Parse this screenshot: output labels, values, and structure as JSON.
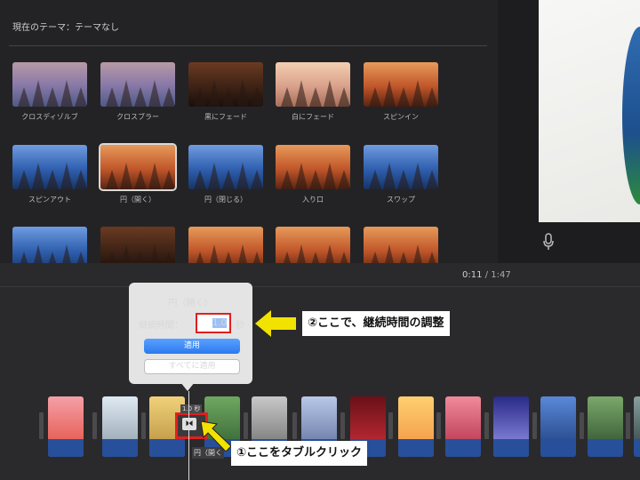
{
  "browser": {
    "theme_label": "現在のテーマ：テーマなし",
    "transitions": [
      {
        "label": "クロスディゾルブ",
        "style": "misty"
      },
      {
        "label": "クロスブラー",
        "style": "misty"
      },
      {
        "label": "黒にフェード",
        "style": "dark"
      },
      {
        "label": "白にフェード",
        "style": "light"
      },
      {
        "label": "スピンイン",
        "style": "forest"
      },
      {
        "label": "スピンアウト",
        "style": "blue"
      },
      {
        "label": "円（開く）",
        "style": "forest",
        "selected": true
      },
      {
        "label": "円（閉じる）",
        "style": "blue"
      },
      {
        "label": "入り口",
        "style": "forest"
      },
      {
        "label": "スワップ",
        "style": "blue"
      },
      {
        "label": "",
        "style": "blue"
      },
      {
        "label": "",
        "style": "dark"
      },
      {
        "label": "",
        "style": "forest"
      },
      {
        "label": "",
        "style": "forest"
      },
      {
        "label": "",
        "style": "forest"
      }
    ]
  },
  "preview": {
    "mic_icon": "microphone-icon"
  },
  "timeline": {
    "time_current": "0:11",
    "time_separator": "/",
    "time_total": "1:47"
  },
  "popover": {
    "title": "円（開く）",
    "duration_label": "継続時間：",
    "duration_value": "1.0",
    "duration_unit": "秒",
    "apply_label": "適用",
    "apply_all_label": "すべてに適用"
  },
  "transition_marker": {
    "duration_badge": "1.0 秒",
    "title": "円（開く",
    "icon": "transition-icon"
  },
  "annotations": {
    "step2": "②ここで、継続時間の調整",
    "step1": "①ここをタブルクリック"
  },
  "colors": {
    "highlight_red": "#e01f1f",
    "arrow_yellow": "#f2e200",
    "apply_blue": "#2a7af0",
    "clip_bar_blue": "#284f9a"
  }
}
